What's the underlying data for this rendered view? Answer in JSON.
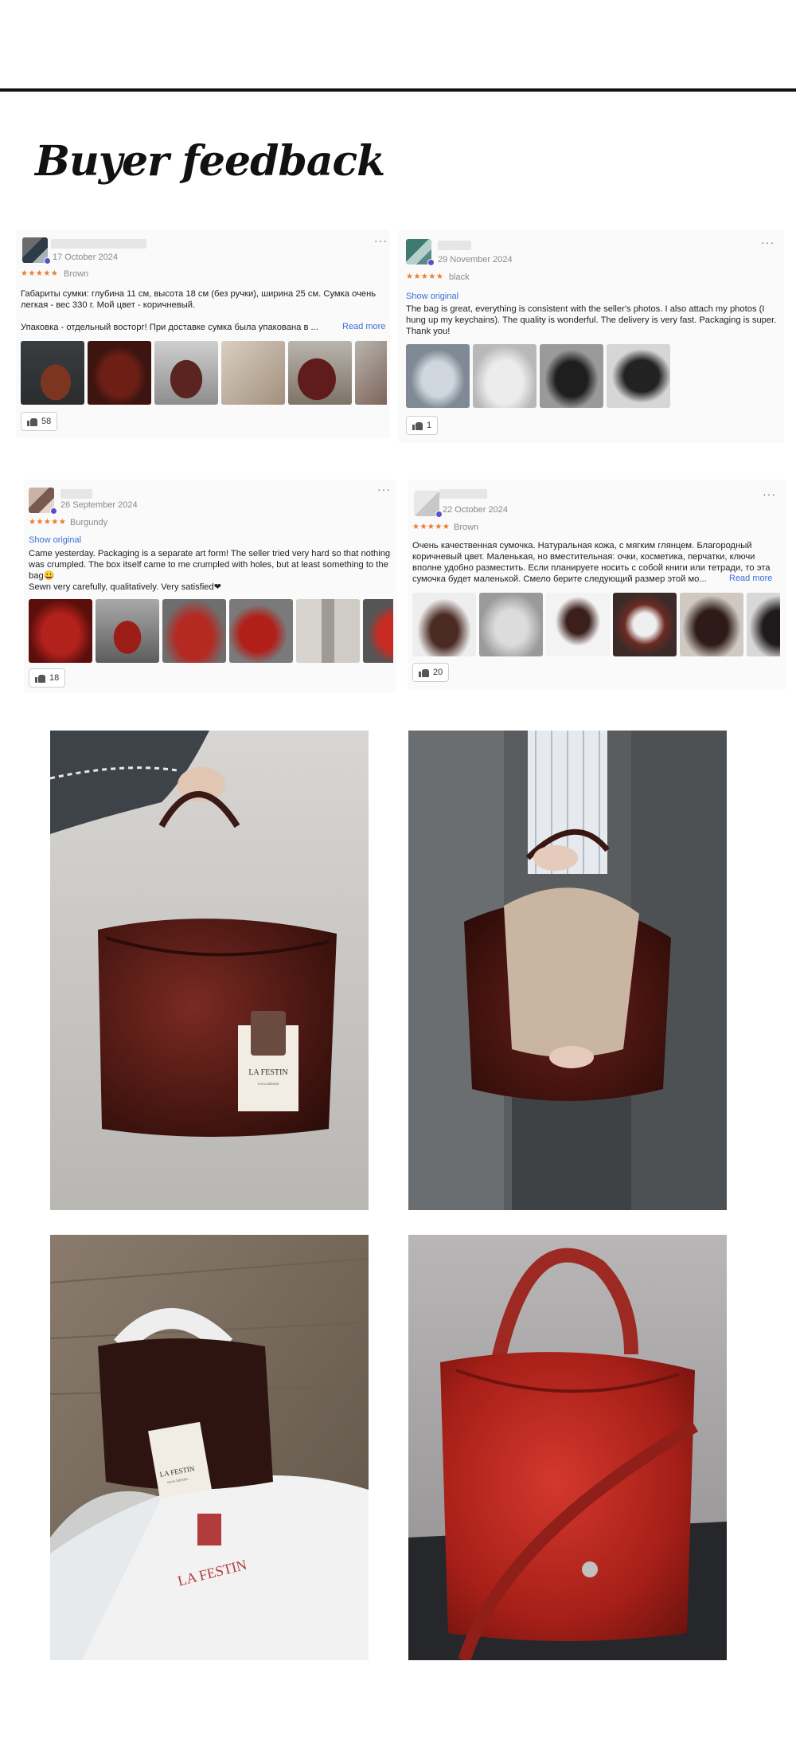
{
  "page": {
    "heading": "Buyer feedback"
  },
  "reviews": [
    {
      "date": "17 October 2024",
      "stars": "★★★★★",
      "variant": "Brown",
      "show_original": "",
      "text": "Габариты сумки: глубина 11 см, высота 18 см (без ручки), ширина 25 см. Сумка очень легкая - вес 330 г. Мой цвет - коричневый.\n\nУпаковка - отдельный восторг! При доставке сумка была упакована в ...",
      "read_more": "Read more",
      "likes": "58"
    },
    {
      "date": "29 November 2024",
      "stars": "★★★★★",
      "variant": "black",
      "show_original": "Show original",
      "text": "The bag is great, everything is consistent with the seller's photos. I also attach my photos (I hung up my keychains). The quality is wonderful. The delivery is very fast. Packaging is super. Thank you!",
      "read_more": "",
      "likes": "1"
    },
    {
      "date": "26 September 2024",
      "stars": "★★★★★",
      "variant": "Burgundy",
      "show_original": "Show original",
      "text": "Came yesterday. Packaging is a separate art form! The seller tried very hard so that nothing was crumpled. The box itself came to me crumpled with holes, but at least something to the bag😀\nSewn very carefully, qualitatively. Very satisfied❤",
      "read_more": "",
      "likes": "18"
    },
    {
      "date": "22 October 2024",
      "stars": "★★★★★",
      "variant": "Brown",
      "show_original": "",
      "text": "Очень качественная сумочка. Натуральная кожа, с мягким глянцем. Благородный коричневый цвет. Маленькая, но вместительная: очки, косметика, перчатки, ключи вполне удобно разместить. Если планируете носить с собой книги или тетради, то эта сумочка будет маленькой. Смело берите следующий размер этой мо...",
      "read_more": "Read more",
      "likes": "20"
    }
  ],
  "photos": [
    {
      "tag_brand": "LA FESTIN",
      "tag_sub": "www.lafestin"
    },
    {
      "tag_brand": "",
      "tag_sub": ""
    },
    {
      "tag_brand": "LA FESTIN",
      "tag_sub": "www.lafestin",
      "pouch_brand": "LA FESTIN"
    },
    {
      "tag_brand": "",
      "tag_sub": ""
    }
  ],
  "colors": {
    "star": "#ef7a2a",
    "link": "#3a6fd6",
    "rule": "#111111"
  },
  "icons": {
    "like": "thumbs-up-icon",
    "menu": "more-dots-icon",
    "verified": "verified-dot-icon"
  }
}
